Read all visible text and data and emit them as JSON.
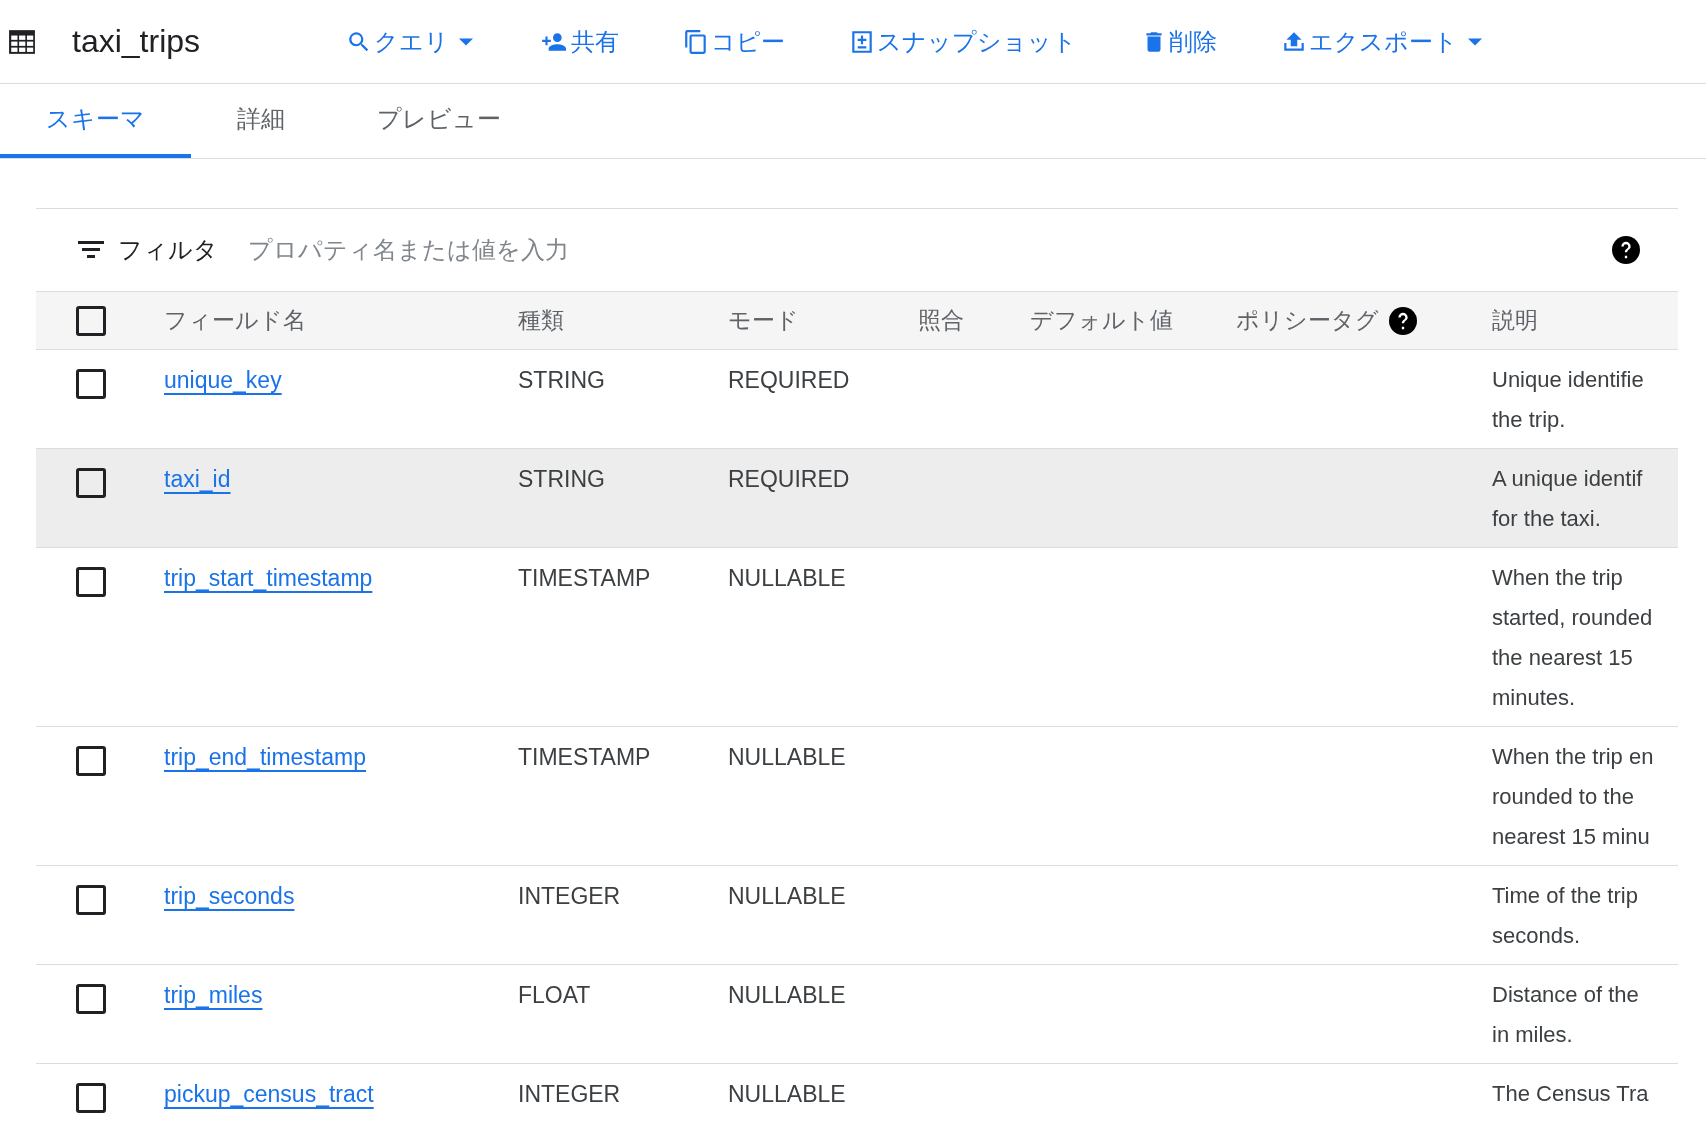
{
  "title": "taxi_trips",
  "actions": [
    {
      "label": "クエリ",
      "kind": "search",
      "dropdown": true
    },
    {
      "label": "共有",
      "kind": "share",
      "dropdown": false
    },
    {
      "label": "コピー",
      "kind": "copy",
      "dropdown": false
    },
    {
      "label": "スナップショット",
      "kind": "snapshot",
      "dropdown": false
    },
    {
      "label": "削除",
      "kind": "delete",
      "dropdown": false
    },
    {
      "label": "エクスポート",
      "kind": "export",
      "dropdown": true
    }
  ],
  "tabs": [
    {
      "label": "スキーマ",
      "selected": true
    },
    {
      "label": "詳細",
      "selected": false
    },
    {
      "label": "プレビュー",
      "selected": false
    }
  ],
  "filter": {
    "label": "フィルタ",
    "placeholder": "プロパティ名または値を入力"
  },
  "table": {
    "select_all_checked": false,
    "columns": [
      "フィールド名",
      "種類",
      "モード",
      "照合",
      "デフォルト値",
      "ポリシータグ",
      "説明"
    ],
    "rows": [
      {
        "name": "unique_key",
        "type": "STRING",
        "mode": "REQUIRED",
        "description": [
          "Unique identifie",
          "the trip."
        ],
        "checked": false,
        "highlighted": false
      },
      {
        "name": "taxi_id",
        "type": "STRING",
        "mode": "REQUIRED",
        "description": [
          "A unique identif",
          "for the taxi."
        ],
        "checked": false,
        "highlighted": true
      },
      {
        "name": "trip_start_timestamp",
        "type": "TIMESTAMP",
        "mode": "NULLABLE",
        "description": [
          "When the trip",
          "started, rounded",
          "the nearest 15",
          "minutes."
        ],
        "checked": false,
        "highlighted": false
      },
      {
        "name": "trip_end_timestamp",
        "type": "TIMESTAMP",
        "mode": "NULLABLE",
        "description": [
          "When the trip en",
          "rounded to the",
          "nearest 15 minu"
        ],
        "checked": false,
        "highlighted": false
      },
      {
        "name": "trip_seconds",
        "type": "INTEGER",
        "mode": "NULLABLE",
        "description": [
          "Time of the trip",
          "seconds."
        ],
        "checked": false,
        "highlighted": false
      },
      {
        "name": "trip_miles",
        "type": "FLOAT",
        "mode": "NULLABLE",
        "description": [
          "Distance of the",
          "in miles."
        ],
        "checked": false,
        "highlighted": false
      },
      {
        "name": "pickup_census_tract",
        "type": "INTEGER",
        "mode": "NULLABLE",
        "description": [
          "The Census Tra"
        ],
        "checked": false,
        "highlighted": false
      }
    ]
  }
}
